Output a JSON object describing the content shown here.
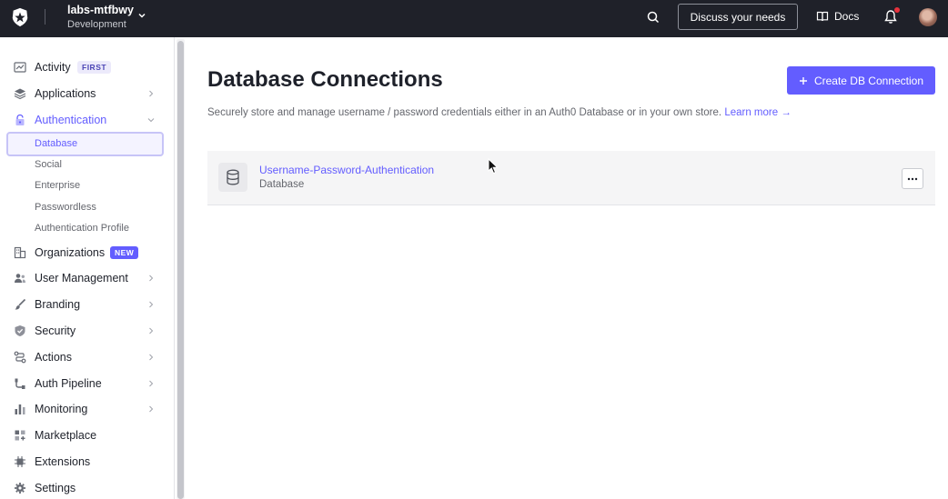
{
  "topbar": {
    "tenant_name": "labs-mtfbwy",
    "tenant_env": "Development",
    "discuss_label": "Discuss your needs",
    "docs_label": "Docs"
  },
  "sidebar": {
    "items": [
      {
        "label": "Activity",
        "icon": "activity-icon",
        "badge": "FIRST"
      },
      {
        "label": "Applications",
        "icon": "applications-icon"
      },
      {
        "label": "Authentication",
        "icon": "lock-icon"
      },
      {
        "label": "Organizations",
        "icon": "organizations-icon",
        "badge": "NEW"
      },
      {
        "label": "User Management",
        "icon": "users-icon"
      },
      {
        "label": "Branding",
        "icon": "brush-icon"
      },
      {
        "label": "Security",
        "icon": "shield-icon"
      },
      {
        "label": "Actions",
        "icon": "actions-icon"
      },
      {
        "label": "Auth Pipeline",
        "icon": "pipeline-icon"
      },
      {
        "label": "Monitoring",
        "icon": "chart-icon"
      },
      {
        "label": "Marketplace",
        "icon": "marketplace-icon"
      },
      {
        "label": "Extensions",
        "icon": "extensions-icon"
      },
      {
        "label": "Settings",
        "icon": "gear-icon"
      }
    ],
    "auth_subitems": [
      "Database",
      "Social",
      "Enterprise",
      "Passwordless",
      "Authentication Profile"
    ]
  },
  "main": {
    "title": "Database Connections",
    "create_label": "Create DB Connection",
    "subtitle": "Securely store and manage username / password credentials either in an Auth0 Database or in your own store.",
    "learn_more": "Learn more →",
    "connections": [
      {
        "name": "Username-Password-Authentication",
        "type": "Database"
      }
    ]
  },
  "colors": {
    "accent": "#635dff",
    "topbar": "#1f2129",
    "notification": "#e8323d"
  }
}
